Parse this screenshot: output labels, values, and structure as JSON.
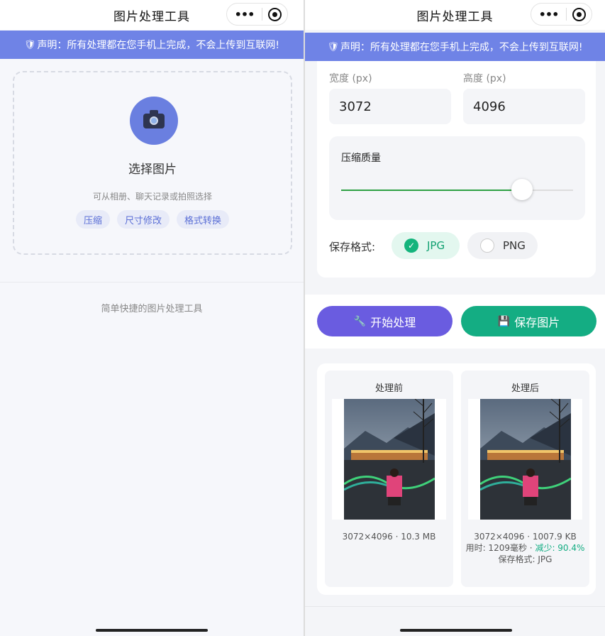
{
  "app": {
    "title": "图片处理工具"
  },
  "notice": {
    "icon": "shield-icon",
    "text": "声明：所有处理都在您手机上完成，不会上传到互联网!"
  },
  "capsule": {
    "more_icon": "more-dots-icon",
    "close_icon": "target-icon"
  },
  "upload": {
    "title": "选择图片",
    "subtitle": "可从相册、聊天记录或拍照选择",
    "icon": "camera-icon",
    "tags": [
      "压缩",
      "尺寸修改",
      "格式转换"
    ]
  },
  "footer": {
    "text": "简单快捷的图片处理工具"
  },
  "settings": {
    "width_label": "宽度 (px)",
    "width_value": "3072",
    "height_label": "高度 (px)",
    "height_value": "4096",
    "quality_label": "压缩质量",
    "quality_fraction": 0.78,
    "format_label": "保存格式:",
    "formats": [
      {
        "label": "JPG",
        "selected": true
      },
      {
        "label": "PNG",
        "selected": false
      }
    ]
  },
  "actions": {
    "process_label": "开始处理",
    "process_icon": "wrench-icon",
    "save_label": "保存图片",
    "save_icon": "floppy-disk-icon"
  },
  "compare": {
    "before": {
      "title": "处理前",
      "info": "3072×4096 · 10.3 MB"
    },
    "after": {
      "title": "处理后",
      "info": "3072×4096 · 1007.9 KB",
      "time": "用时: 1209毫秒 ·",
      "reduction": "减少: 90.4%",
      "format": "保存格式: JPG"
    }
  },
  "colors": {
    "accent": "#6f83e6",
    "process_button": "#6a5ce0",
    "save_button": "#14ad83",
    "selected_format": "#14b47c",
    "slider": "#2ea043"
  }
}
